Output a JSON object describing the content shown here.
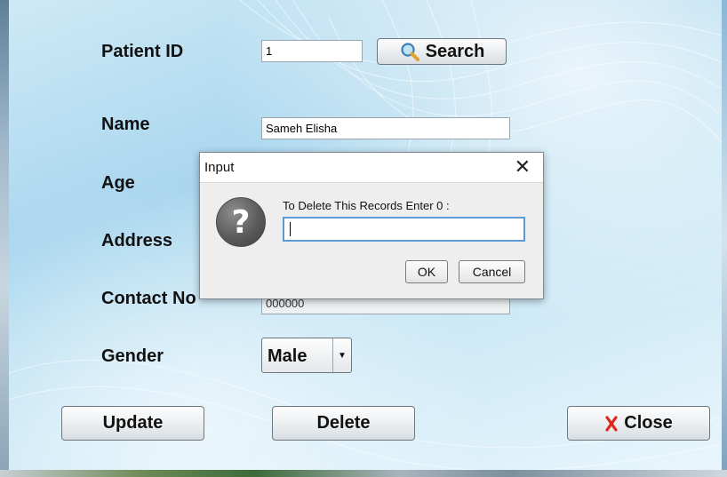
{
  "form": {
    "patient_id_label": "Patient ID",
    "patient_id_value": "1",
    "search_label": "Search",
    "name_label": "Name",
    "name_value": "Sameh Elisha",
    "age_label": "Age",
    "address_label": "Address",
    "contact_label": "Contact No",
    "contact_value": "000000",
    "gender_label": "Gender",
    "gender_value": "Male"
  },
  "actions": {
    "update_label": "Update",
    "delete_label": "Delete",
    "close_label": "Close"
  },
  "dialog": {
    "title": "Input",
    "message": "To Delete This Records Enter 0 :",
    "input_value": "",
    "ok_label": "OK",
    "cancel_label": "Cancel"
  },
  "icons": {
    "search": "magnifier-icon",
    "close": "red-x-icon",
    "question": "question-icon",
    "dropdown": "chevron-down-icon"
  },
  "colors": {
    "close_icon": "#e3241b",
    "input_focus": "#5d9ad6",
    "panel_bg": "#bfe3f4"
  }
}
